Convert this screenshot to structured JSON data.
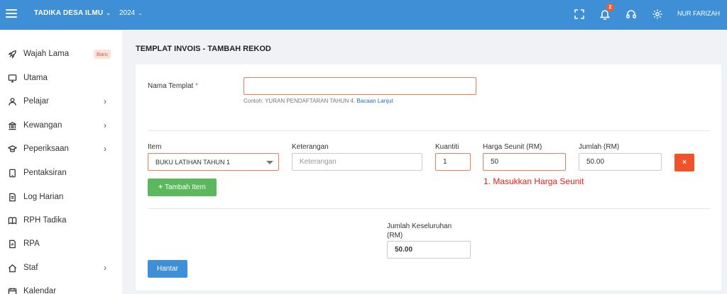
{
  "topbar": {
    "school": "TADIKA DESA ILMU",
    "year": "2024",
    "notification_count": "2",
    "user": "NUR FARIZAH"
  },
  "sidebar": {
    "items": [
      {
        "label": "Wajah Lama",
        "badge": "Baru",
        "icon": "rocket-icon",
        "has_submenu": false
      },
      {
        "label": "Utama",
        "icon": "monitor-icon",
        "has_submenu": false
      },
      {
        "label": "Pelajar",
        "icon": "user-icon",
        "has_submenu": true
      },
      {
        "label": "Kewangan",
        "icon": "bank-icon",
        "has_submenu": true
      },
      {
        "label": "Peperiksaan",
        "icon": "graduation-cap-icon",
        "has_submenu": true
      },
      {
        "label": "Pentaksiran",
        "icon": "tablet-icon",
        "has_submenu": false
      },
      {
        "label": "Log Harian",
        "icon": "log-icon",
        "has_submenu": false
      },
      {
        "label": "RPH Tadika",
        "icon": "book-icon",
        "has_submenu": false
      },
      {
        "label": "RPA",
        "icon": "report-icon",
        "has_submenu": false
      },
      {
        "label": "Staf",
        "icon": "home-icon",
        "has_submenu": true
      },
      {
        "label": "Kalendar",
        "icon": "calendar-icon",
        "has_submenu": false
      }
    ]
  },
  "page": {
    "title": "TEMPLAT INVOIS - TAMBAH REKOD"
  },
  "form": {
    "template_name_label": "Nama Templat",
    "required_mark": "*",
    "template_name_value": "",
    "hint_text": "Contoh: YURAN PENDAFTARAN TAHUN 4.",
    "hint_link": "Bacaan Lanjut",
    "item_label": "Item",
    "item_value": "BUKU LATIHAN TAHUN 1",
    "description_label": "Keterangan",
    "description_placeholder": "Keterangan",
    "quantity_label": "Kuantiti",
    "quantity_value": "1",
    "unit_price_label": "Harga Seunit (RM)",
    "unit_price_value": "50",
    "amount_label": "Jumlah (RM)",
    "amount_value": "50.00",
    "delete_label": "×",
    "add_item_label": "Tambah Item",
    "error_message": "1. Masukkan Harga Seunit",
    "total_label_line1": "Jumlah Keseluruhan",
    "total_label_line2": "(RM)",
    "total_value": "50.00",
    "submit_label": "Hantar"
  },
  "colors": {
    "primary": "#3f8fd6",
    "danger": "#f0532b",
    "success": "#5cb85c",
    "error_text": "#e8201a"
  }
}
